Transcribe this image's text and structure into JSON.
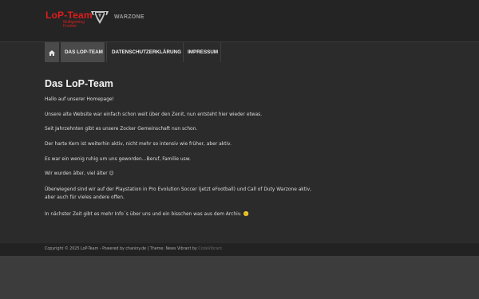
{
  "brand": {
    "title": "LoP-Team",
    "subtitle_lines": [
      "Multigaming",
      "Frontier"
    ],
    "partner_logo": "WARZONE",
    "emblem_icon": "team-emblem-icon"
  },
  "nav": {
    "home_icon": "home-icon",
    "items": [
      {
        "label": "Das LoP-Team",
        "active": true
      },
      {
        "label": "Datenschutzerklärung",
        "active": false
      },
      {
        "label": "Impressum",
        "active": false
      }
    ]
  },
  "main": {
    "title": "Das LoP-Team",
    "paragraphs": [
      "Hallo auf unserer Homepage!",
      "Unsere alte Website war einfach schon weit über den Zenit, nun entsteht hier wieder etwas.",
      "Seit Jahrzehnten gibt es unsere Zocker Gemeinschaft nun schon.",
      "Der harte Kern ist weiterhin aktiv, nicht mehr so intensiv wie früher, aber aktiv.",
      "Es war ein wenig ruhig um uns geworden…Beruf, Familie usw.",
      "Wir wurden älter, viel älter 😉",
      "Überwiegend sind wir auf der Playstation in Pro Evolution Soccer (jetzt eFootball) und Call of Duty Warzone aktiv,",
      "aber auch für vieles andere offen.",
      "In nächster Zeit gibt es mehr Info´s über uns und ein bisschen was aus dem Archiv. 🙂"
    ]
  },
  "footer": {
    "text": "Copyright © 2025 LoP-Team - Powered by chaniny.de | Theme: News Vibrant by ",
    "link": "CodeVibrant."
  },
  "colors": {
    "accent_red": "#e01c1c",
    "page_bg": "#3c3c3c",
    "content_bg": "#2b2b2b",
    "header_bg": "#242424"
  }
}
